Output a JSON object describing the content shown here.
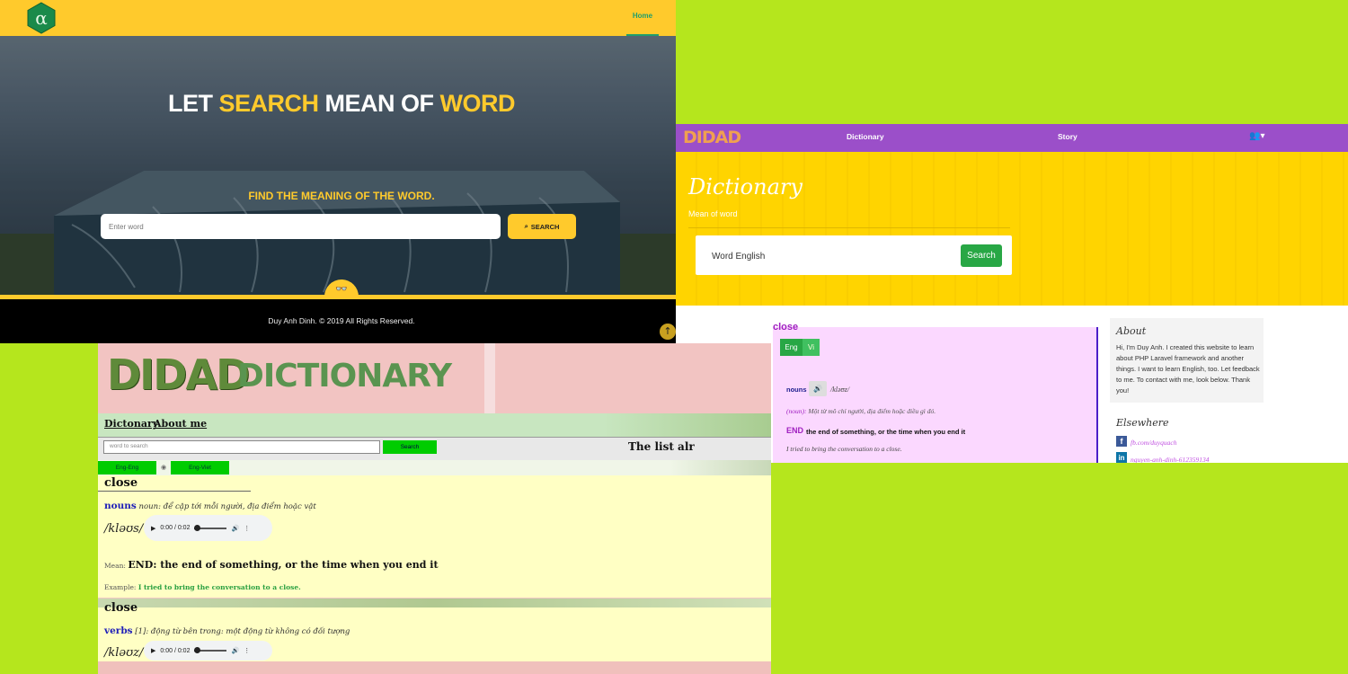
{
  "panel1": {
    "nav": {
      "home": "Home"
    },
    "headline": {
      "part1": "LET ",
      "part2": "SEARCH",
      "part3": " MEAN OF ",
      "part4": "WORD"
    },
    "subtitle": "FIND THE MEANING OF THE WORD.",
    "search": {
      "placeholder": "Enter word",
      "button": "SEARCH"
    },
    "footer": {
      "copyright": "Duy Anh Dinh. © 2019 All Rights Reserved."
    },
    "colors": {
      "accent": "#ffca2c",
      "nav_link": "#1f9e6d"
    }
  },
  "panel2": {
    "logo": "DIDAD",
    "nav": {
      "dictionary": "Dictionary",
      "story": "Story",
      "users_icon": "users-icon"
    },
    "title": "Dictionary",
    "subtitle": "Mean of word",
    "search": {
      "value": "Word English",
      "button": "Search"
    },
    "entry": {
      "word": "close",
      "tabs": {
        "eng": "Eng",
        "vi": "Vi"
      },
      "pos": "nouns",
      "pronunciation": "/kləʊz/",
      "vi_label": "(noun):",
      "vi_meaning": " Một từ mô chỉ người, địa điểm hoặc điều gì đó.",
      "def_keyword": "END",
      "definition": "the end of something, or the time when you end it",
      "example": "I tried to bring the conversation to a close."
    },
    "sidebar": {
      "about_title": "About",
      "about_text": "Hi, I'm Duy Anh. I created this website to learn about PHP Laravel framework and another things. I want to learn English, too. Let feedback to me. To contact with me, look below. Thank you!",
      "elsewhere_title": "Elsewhere",
      "facebook": "fb.com/duyquach",
      "linkedin": "nguyen-anh-dinh-612359134"
    },
    "colors": {
      "nav": "#9b4fc9",
      "band": "#ffd400",
      "button": "#28a745",
      "card": "#fbd8ff"
    }
  },
  "panel3": {
    "logo": "DIDAD",
    "logo_word": "DICTIONARY",
    "nav": {
      "dictionary": "Dictonary",
      "about": "About me"
    },
    "search": {
      "placeholder": "word to search",
      "button": "Search"
    },
    "list_title": "The list alr",
    "lang": {
      "a": "Eng-Eng",
      "b": "Eng-Viet"
    },
    "entries": [
      {
        "word": "close",
        "pos": "nouns",
        "vi": " noun: để cập tới mỗi người, địa điểm hoặc vật",
        "ipa": "/kləʊs/",
        "audio_time": "0:00 / 0:02",
        "mean_label": "Mean: ",
        "mean": "END: the end of something, or the time when you end it",
        "example_label": "Example: ",
        "example": "I tried to bring the conversation to a close."
      },
      {
        "word": "close",
        "pos": "verbs",
        "vi": " [1]: động từ bên trong: một động từ không có đối tượng",
        "ipa": "/kləʊz/",
        "audio_time": "0:00 / 0:02"
      }
    ],
    "colors": {
      "entry_bg": "#ffffc4",
      "button": "#00cc00",
      "pos": "#2020b8",
      "example": "#2aa040"
    }
  }
}
